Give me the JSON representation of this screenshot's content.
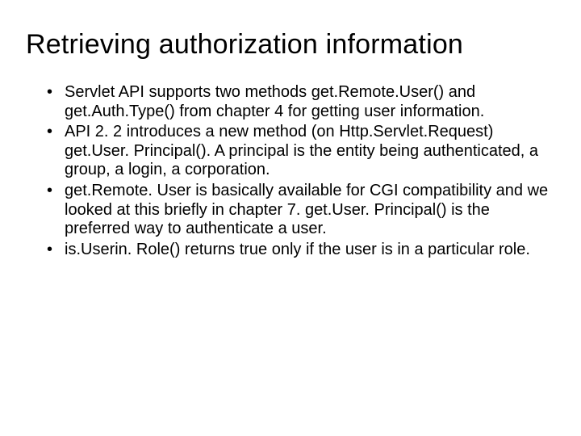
{
  "title": "Retrieving authorization information",
  "bullets": [
    "Servlet API supports two methods get.Remote.User() and get.Auth.Type() from chapter 4 for getting user information.",
    "API 2. 2 introduces a new method (on Http.Servlet.Request) get.User. Principal().  A principal is the entity being authenticated, a group, a login, a corporation.",
    "get.Remote. User is basically available for CGI compatibility and we looked at this briefly in chapter 7. get.User. Principal() is the preferred way to authenticate a user.",
    "is.Userin. Role() returns true only if the user is in a particular role."
  ]
}
